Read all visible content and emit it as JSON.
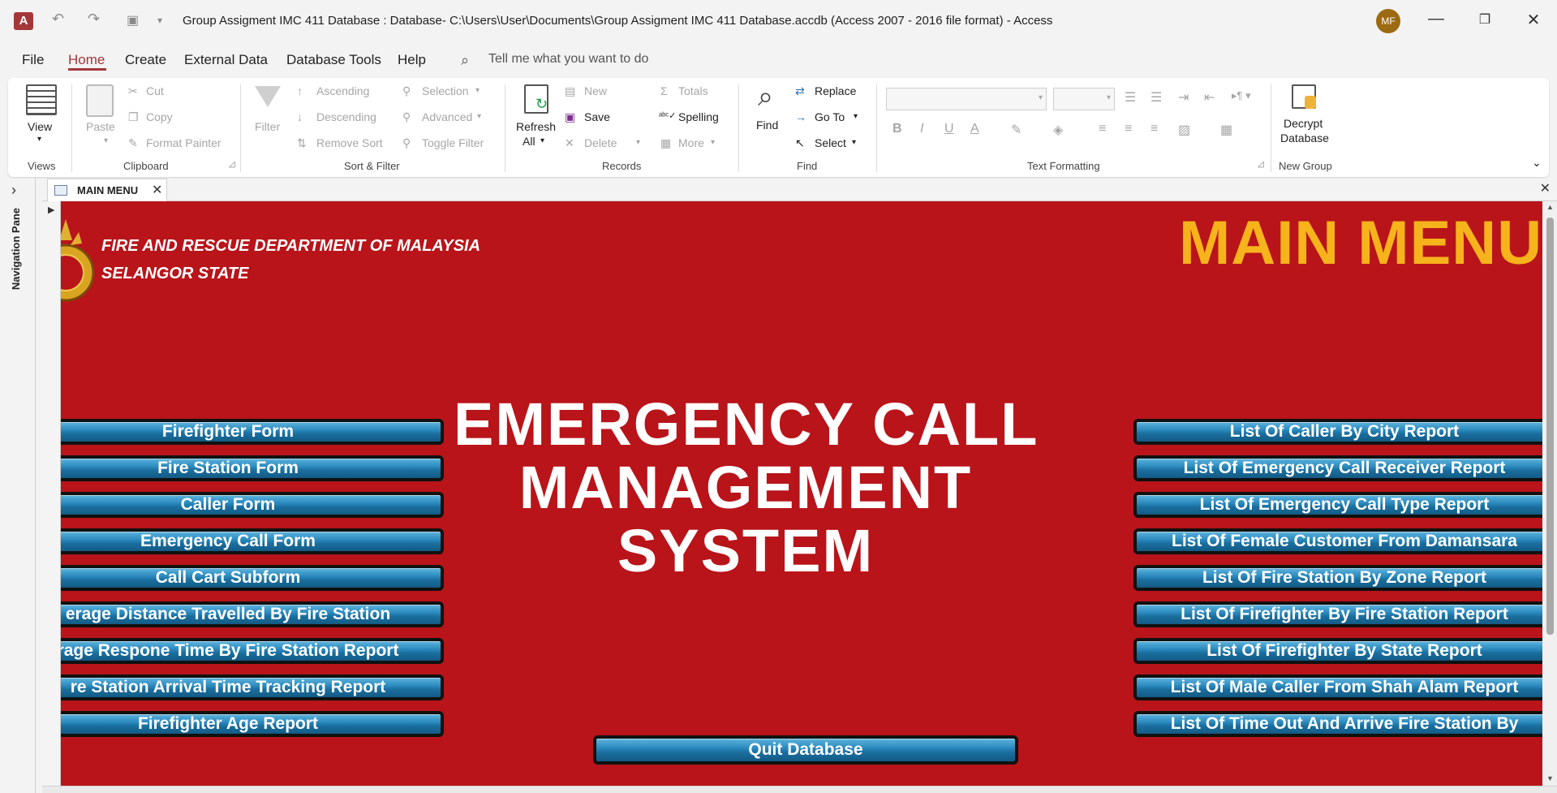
{
  "titlebar": {
    "app_icon": "A",
    "title": "Group Assigment IMC 411 Database : Database- C:\\Users\\User\\Documents\\Group Assigment IMC 411 Database.accdb (Access 2007 - 2016 file format)  -  Access",
    "avatar": "MF",
    "undo_icon": "undo-icon",
    "redo_icon": "redo-icon"
  },
  "menu": {
    "tabs": [
      "File",
      "Home",
      "Create",
      "External Data",
      "Database Tools",
      "Help"
    ],
    "active": "Home",
    "tell_me": "Tell me what you want to do"
  },
  "ribbon": {
    "views": {
      "view": "View",
      "group": "Views"
    },
    "clipboard": {
      "paste": "Paste",
      "cut": "Cut",
      "copy": "Copy",
      "format_painter": "Format Painter",
      "group": "Clipboard"
    },
    "sort_filter": {
      "filter": "Filter",
      "ascending": "Ascending",
      "descending": "Descending",
      "remove_sort": "Remove Sort",
      "selection": "Selection",
      "advanced": "Advanced",
      "toggle_filter": "Toggle Filter",
      "group": "Sort & Filter"
    },
    "records": {
      "refresh": "Refresh",
      "refresh_all": "All",
      "new": "New",
      "save": "Save",
      "delete": "Delete",
      "totals": "Totals",
      "spelling": "Spelling",
      "more": "More",
      "group": "Records"
    },
    "find": {
      "find": "Find",
      "replace": "Replace",
      "goto": "Go To",
      "select": "Select",
      "group": "Find"
    },
    "text_formatting": {
      "bold": "B",
      "italic": "I",
      "underline": "U",
      "font_color": "A",
      "group": "Text Formatting"
    },
    "new_group": {
      "decrypt_1": "Decrypt",
      "decrypt_2": "Database",
      "group": "New Group"
    }
  },
  "nav_pane": {
    "label": "Navigation Pane"
  },
  "doc_tab": {
    "label": "MAIN MENU"
  },
  "form": {
    "dept_line1": "FIRE AND RESCUE DEPARTMENT OF MALAYSIA",
    "dept_line2": "SELANGOR STATE",
    "main_menu": "MAIN MENU",
    "title_line1": "EMERGENCY CALL",
    "title_line2": "MANAGEMENT",
    "title_line3": "SYSTEM",
    "left_buttons": [
      "Firefighter Form",
      "Fire Station Form",
      "Caller Form",
      "Emergency Call Form",
      "Call Cart Subform",
      "erage Distance Travelled By Fire Station",
      "rage Respone Time By Fire Station Report",
      "re Station Arrival Time Tracking Report",
      "Firefighter Age Report"
    ],
    "right_buttons": [
      "List Of Caller By City Report",
      "List Of Emergency Call Receiver Report",
      "List Of Emergency Call Type Report",
      "List Of Female Customer From Damansara",
      "List Of Fire Station By Zone Report",
      "List Of Firefighter By Fire Station Report",
      "List Of Firefighter By State Report",
      "List Of Male Caller From Shah Alam Report",
      "List Of Time Out And Arrive Fire Station By"
    ],
    "quit": "Quit Database"
  },
  "colors": {
    "form_bg": "#b8141a",
    "main_menu": "#f7b31b",
    "accent": "#a4373a",
    "button": "#2c8bbf"
  }
}
